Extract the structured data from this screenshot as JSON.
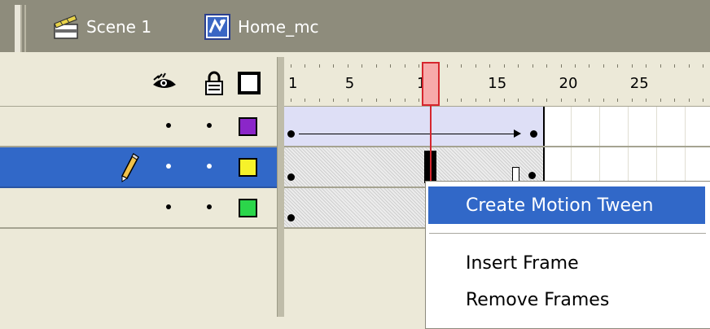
{
  "breadcrumb": {
    "scene_label": "Scene 1",
    "scene_icon": "clapperboard-icon",
    "clip_label": "Home_mc",
    "clip_icon": "movieclip-symbol-icon"
  },
  "layer_header": {
    "icons": [
      "eye-icon",
      "lock-icon",
      "outline-icon"
    ]
  },
  "layers": [
    {
      "color": "#8b26c9",
      "selected": false,
      "editing": false
    },
    {
      "color": "#f6f22a",
      "selected": true,
      "editing": true
    },
    {
      "color": "#2bd64a",
      "selected": false,
      "editing": false
    }
  ],
  "ruler": {
    "labels": [
      "1",
      "5",
      "10",
      "15",
      "20",
      "25"
    ],
    "current_frame": 10
  },
  "context_menu": {
    "items": [
      {
        "label": "Create Motion Tween",
        "highlighted": true
      },
      {
        "label": "Insert Frame",
        "highlighted": false
      },
      {
        "label": "Remove Frames",
        "highlighted": false
      }
    ]
  },
  "colors": {
    "selection": "#3168c8",
    "playhead": "#d6262e",
    "tween_fill": "#dedff6"
  }
}
